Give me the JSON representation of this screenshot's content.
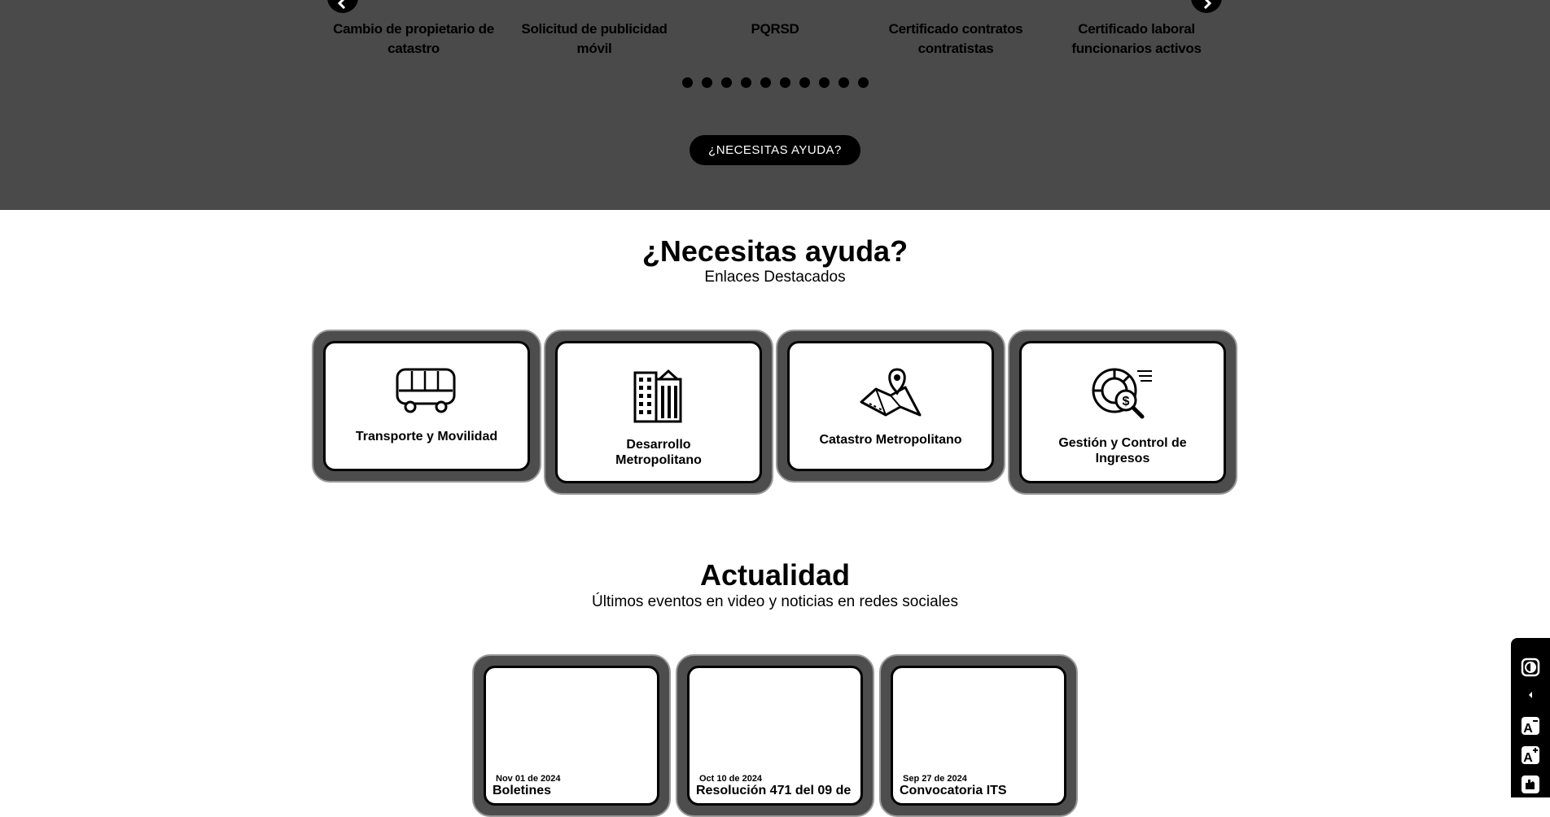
{
  "carousel": {
    "slides": [
      "Cambio de propietario de catastro",
      "Solicitud de publicidad móvil",
      "PQRSD",
      "Certificado contratos contratistas",
      "Certificado laboral funcionarios activos"
    ],
    "dot_count": 10,
    "help_button": "¿NECESITAS AYUDA?"
  },
  "help_section": {
    "title": "¿Necesitas ayuda?",
    "subtitle": "Enlaces Destacados",
    "cards": [
      {
        "label": "Transporte y Movilidad",
        "icon": "bus-icon"
      },
      {
        "label": "Desarrollo Metropolitano",
        "icon": "buildings-icon"
      },
      {
        "label": "Catastro Metropolitano",
        "icon": "map-pin-icon"
      },
      {
        "label": "Gestión y Control de Ingresos",
        "icon": "money-search-icon"
      }
    ]
  },
  "news_section": {
    "title": "Actualidad",
    "subtitle": "Últimos eventos en video y noticias en redes sociales",
    "items": [
      {
        "date": "Nov 01 de 2024",
        "title": "Boletines"
      },
      {
        "date": "Oct 10 de 2024",
        "title": "Resolución 471 del 09 de"
      },
      {
        "date": "Sep 27 de 2024",
        "title": "Convocatoria ITS"
      }
    ]
  },
  "accessibility_bar": {
    "items": [
      "contrast-icon",
      "collapse-arrow-icon",
      "decrease-font-icon",
      "increase-font-icon",
      "sign-language-icon"
    ]
  }
}
